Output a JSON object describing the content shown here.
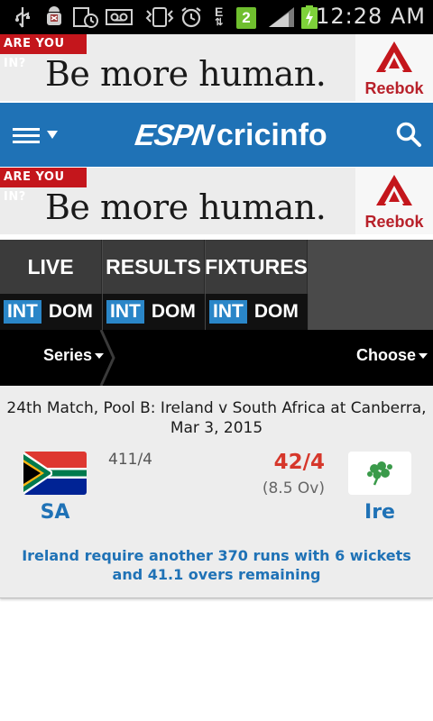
{
  "status_bar": {
    "time": "12:28 AM",
    "sim_number": "2",
    "network_type": "E",
    "icons": [
      "usb-icon",
      "android-debug-icon",
      "screenshot-icon",
      "voicemail-icon",
      "vibrate-icon",
      "alarm-icon",
      "network-e-icon",
      "sim-2-icon",
      "signal-icon",
      "battery-charging-icon"
    ]
  },
  "ads": {
    "tag": "ARE YOU IN?",
    "headline": "Be more human.",
    "brand": "Reebok",
    "brand_color": "#c4161c"
  },
  "header": {
    "logo_espn": "ESPN",
    "logo_cricinfo": "cricinfo",
    "bg_color": "#1f72b6",
    "menu_icon": "menu-icon",
    "search_icon": "search-icon"
  },
  "tabs": [
    {
      "label": "LIVE",
      "active": true,
      "sub": {
        "int": "INT",
        "dom": "DOM"
      }
    },
    {
      "label": "RESULTS",
      "active": false,
      "sub": {
        "int": "INT",
        "dom": "DOM"
      }
    },
    {
      "label": "FIXTURES",
      "active": false,
      "sub": {
        "int": "INT",
        "dom": "DOM"
      }
    }
  ],
  "filters": {
    "series": "Series",
    "choose": "Choose"
  },
  "match": {
    "title": "24th Match, Pool B: Ireland v South Africa at Canberra, Mar 3, 2015",
    "team1": {
      "abbr": "SA",
      "score": "411/4"
    },
    "team2": {
      "abbr": "Ire",
      "score": "42/4",
      "overs": "(8.5 Ov)"
    },
    "status": "Ireland require another 370 runs with 6 wickets and 41.1 overs remaining",
    "accent_color": "#1f72b6",
    "live_score_color": "#d6372b"
  }
}
